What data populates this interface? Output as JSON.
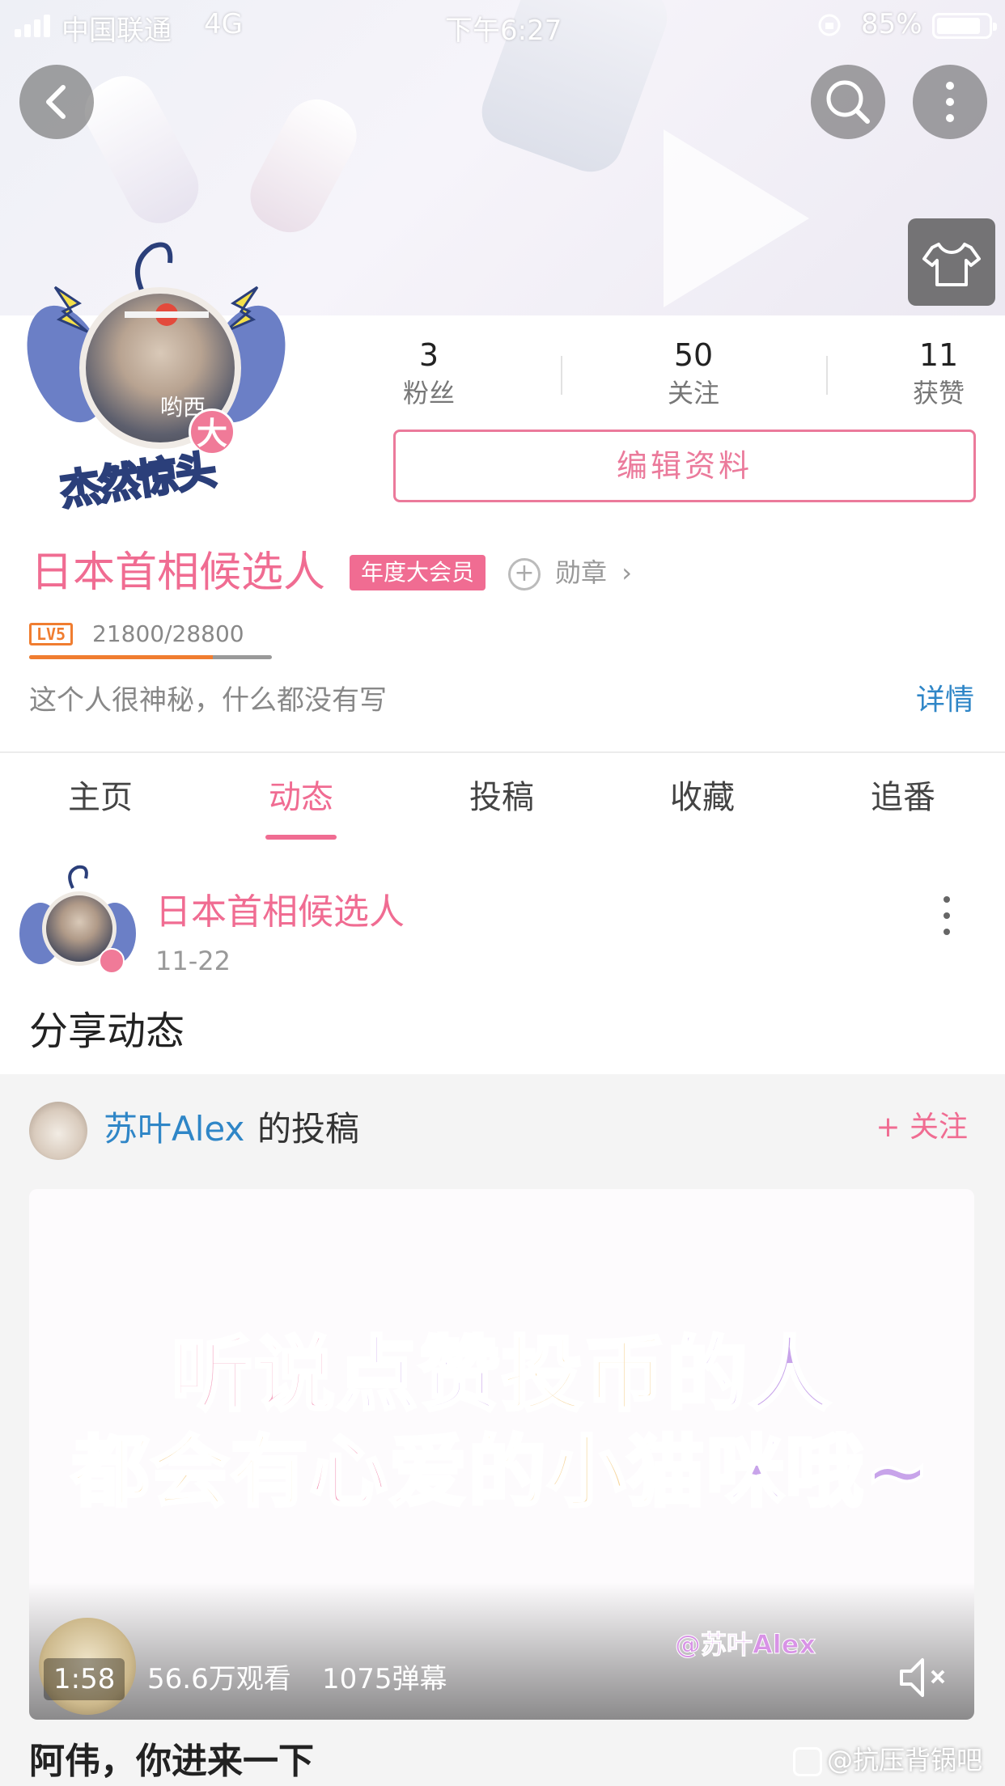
{
  "status_bar": {
    "carrier": "中国联通",
    "network": "4G",
    "time": "下午6:27",
    "battery": "85%",
    "battery_level": 0.85
  },
  "header": {
    "back_icon": "chevron-left-icon",
    "search_icon": "search-icon",
    "more_icon": "more-vertical-icon",
    "theme_icon": "tshirt-icon"
  },
  "avatar": {
    "badge": "大",
    "caption": "杰然惊头",
    "overlay_text": "哟西"
  },
  "stats": [
    {
      "value": "3",
      "label": "粉丝"
    },
    {
      "value": "50",
      "label": "关注"
    },
    {
      "value": "11",
      "label": "获赞"
    }
  ],
  "edit_button": "编辑资料",
  "profile": {
    "name": "日本首相候选人",
    "vip_badge": "年度大会员",
    "medal_label": "勋章",
    "medal_arrow": "›",
    "level": "LV5",
    "exp_text": "21800/28800",
    "exp_progress": 0.757,
    "bio": "这个人很神秘，什么都没有写",
    "detail_link": "详情"
  },
  "tabs": [
    {
      "label": "主页",
      "active": false
    },
    {
      "label": "动态",
      "active": true
    },
    {
      "label": "投稿",
      "active": false
    },
    {
      "label": "收藏",
      "active": false
    },
    {
      "label": "追番",
      "active": false
    }
  ],
  "post": {
    "author": "日本首相候选人",
    "date": "11-22",
    "text": "分享动态",
    "repost": {
      "uploader": "苏叶Alex",
      "suffix": "的投稿",
      "follow_label": "+ 关注",
      "video": {
        "line1": [
          "听说",
          "点赞",
          "投币",
          "的人"
        ],
        "line2": [
          "都会有",
          "心爱",
          "的小猫",
          "咪哦~"
        ],
        "watermark": "@苏叶Alex",
        "duration": "1:58",
        "views": "56.6万观看",
        "danmaku": "1075弹幕",
        "mute_icon": "volume-mute-icon"
      },
      "title": "阿伟，你进来一下"
    }
  },
  "site_watermark": "@抗压背锅吧"
}
